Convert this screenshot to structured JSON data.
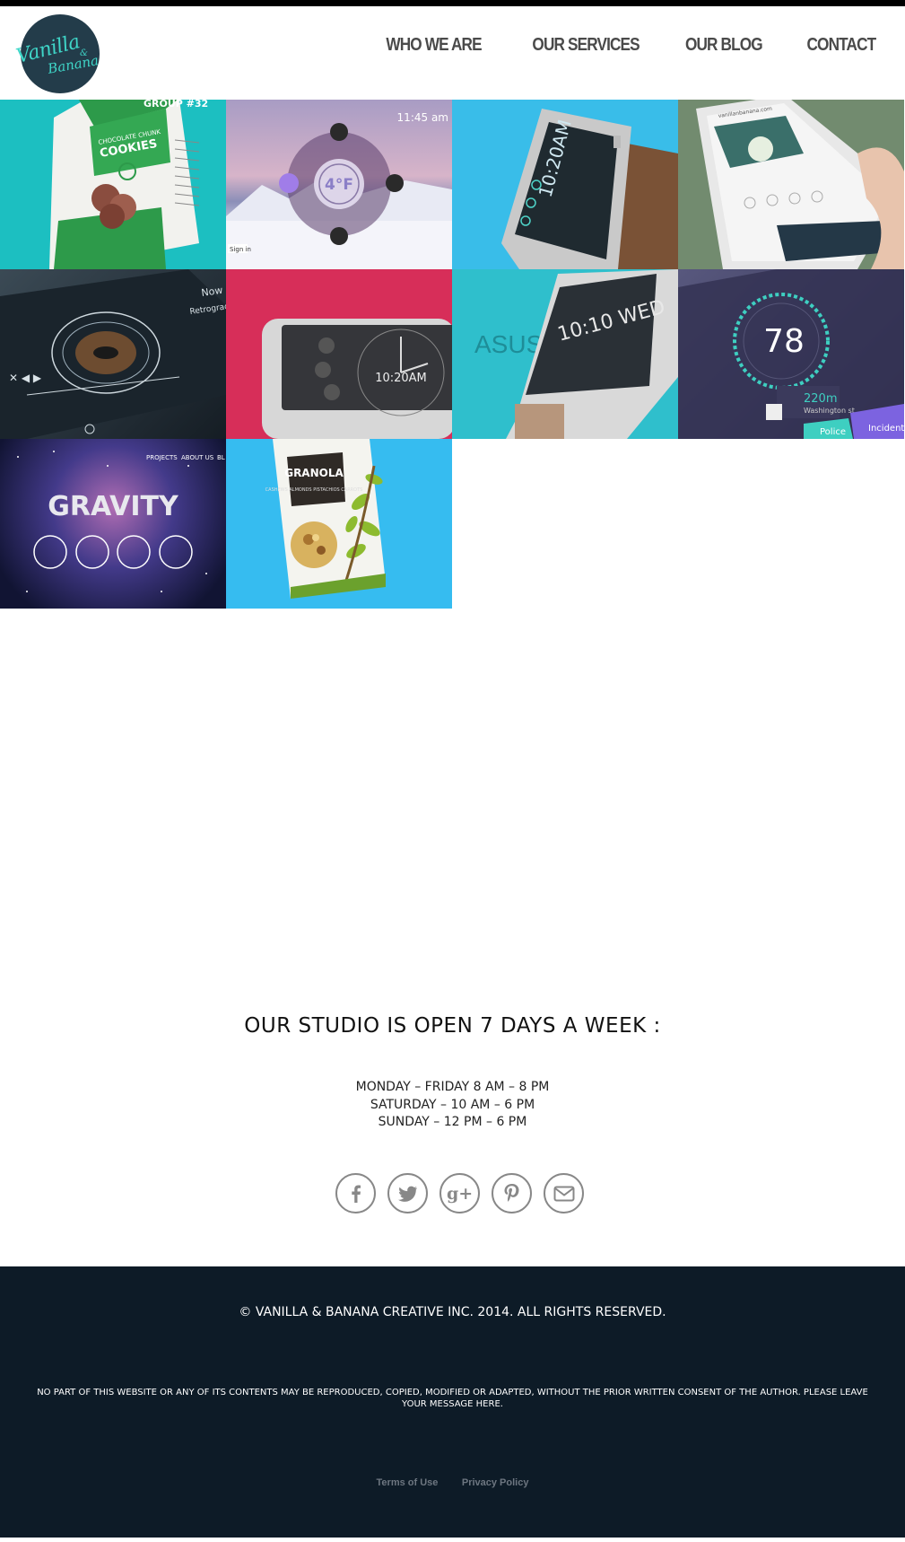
{
  "brand": {
    "logo_line1": "Vanilla",
    "logo_amp": "&",
    "logo_line2": "Banana",
    "logo_color": "#3fd6c8",
    "logo_bg": "#233c4a"
  },
  "nav": {
    "items": [
      "WHO WE ARE",
      "OUR SERVICES",
      "OUR BLOG",
      "CONTACT"
    ]
  },
  "portfolio": {
    "tiles": [
      {
        "bg": "#1cbfc1",
        "text1": "CHOCOLATE CHUNK",
        "text2": "COOKIES",
        "badge": "GROUP #32"
      },
      {
        "bg": "#9e94b8",
        "time": "11:45 am",
        "temp": "4°F",
        "signin": "Sign in"
      },
      {
        "bg": "#39bde9",
        "time": "10:20AM"
      },
      {
        "bg": "#728b6f",
        "url": "vanillanbanana.com"
      },
      {
        "bg": "#1d2a35",
        "heading": "Now Playing",
        "subtext": "Retrograde"
      },
      {
        "bg": "#d72e59",
        "time": "10:20AM"
      },
      {
        "bg": "#2fbfcc",
        "label": "ASUS Z",
        "time": "10:10 WED"
      },
      {
        "bg": "#3d3d66",
        "number": "78",
        "distance": "220m",
        "street": "Washington st",
        "btn1": "Police",
        "btn2": "Incident"
      },
      {
        "bg": "#1c1f47",
        "word": "GRAVITY",
        "menu1": "PROJECTS",
        "menu2": "ABOUT US",
        "menu3": "BL"
      },
      {
        "bg": "#36bcf0",
        "brand": "GRANOLA",
        "text": "CASHEWS ALMONDS PISTACHIOS CARROTS"
      }
    ]
  },
  "studio": {
    "title": "OUR STUDIO IS OPEN 7 DAYS A WEEK :",
    "hours": [
      "MONDAY – FRIDAY 8 AM – 8 PM",
      "SATURDAY – 10 AM – 6 PM",
      "SUNDAY – 12 PM – 6 PM"
    ]
  },
  "social": {
    "icons": [
      "facebook-icon",
      "twitter-icon",
      "google-plus-icon",
      "pinterest-icon",
      "email-icon"
    ]
  },
  "footer": {
    "copyright": "© VANILLA & BANANA CREATIVE INC. 2014. ALL RIGHTS RESERVED.",
    "notice": "NO PART OF THIS WEBSITE OR ANY OF ITS CONTENTS MAY BE REPRODUCED, COPIED, MODIFIED OR ADAPTED, WITHOUT THE PRIOR WRITTEN CONSENT OF THE AUTHOR. PLEASE LEAVE YOUR MESSAGE HERE.",
    "link1": "Terms of Use",
    "link2": "Privacy Policy",
    "bg": "#0d1b27"
  }
}
